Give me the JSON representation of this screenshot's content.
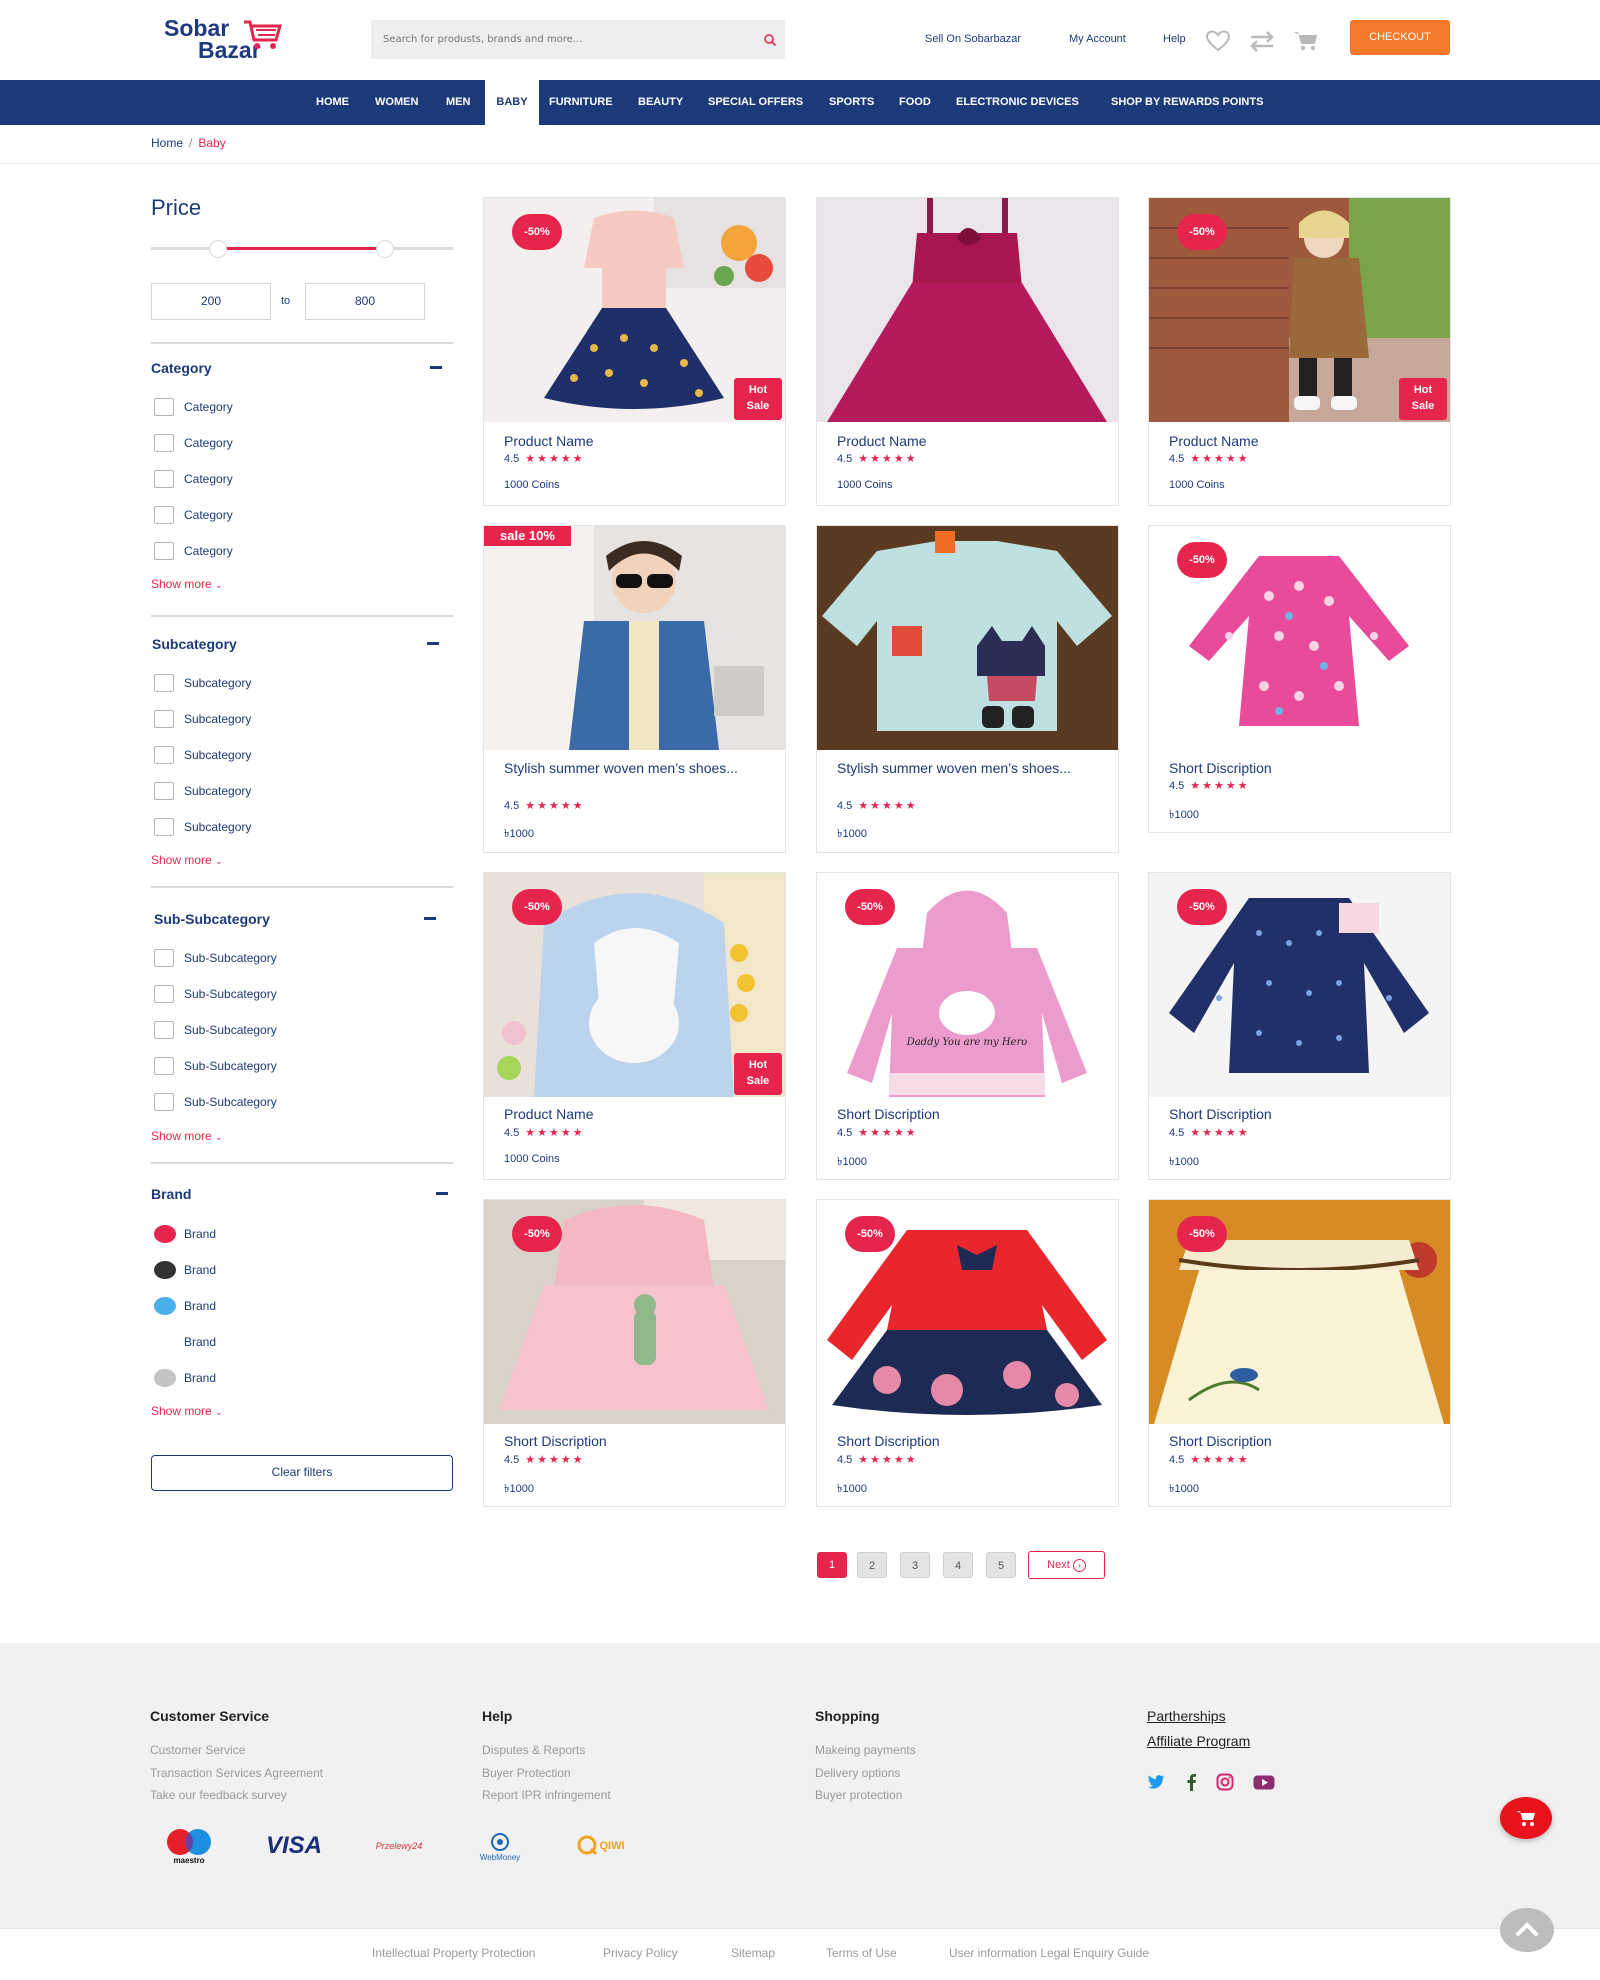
{
  "header": {
    "logo_line1": "Sobar",
    "logo_line2": "Bazar",
    "search_placeholder": "Search for produsts, brands and more...",
    "links": [
      "Sell On Sobarbazar",
      "My Account",
      "Help"
    ],
    "checkout_label": "CHECKOUT",
    "icons": [
      "heart-icon",
      "compare-icon",
      "cart-icon",
      "search-icon"
    ]
  },
  "nav": {
    "items": [
      "HOME",
      "WOMEN",
      "MEN",
      "BABY",
      "FURNITURE",
      "BEAUTY",
      "SPECIAL OFFERS",
      "SPORTS",
      "FOOD",
      "ELECTRONIC DEVICES",
      "SHOP BY REWARDS POINTS"
    ],
    "active": "BABY"
  },
  "breadcrumb": {
    "home": "Home",
    "separator": "/",
    "current": "Baby"
  },
  "sidebar": {
    "price": {
      "title": "Price",
      "min": "200",
      "max": "800",
      "to_label": "to"
    },
    "category": {
      "title": "Category",
      "items": [
        "Category",
        "Category",
        "Category",
        "Category",
        "Category"
      ],
      "show_more": "Show more"
    },
    "subcategory": {
      "title": "Subcategory",
      "items": [
        "Subcategory",
        "Subcategory",
        "Subcategory",
        "Subcategory",
        "Subcategory"
      ],
      "show_more": "Show more"
    },
    "subsubcategory": {
      "title": "Sub-Subcategory",
      "items": [
        "Sub-Subcategory",
        "Sub-Subcategory",
        "Sub-Subcategory",
        "Sub-Subcategory",
        "Sub-Subcategory"
      ],
      "show_more": "Show more"
    },
    "brand": {
      "title": "Brand",
      "items": [
        {
          "label": "Brand",
          "color": "#e6254f"
        },
        {
          "label": "Brand",
          "color": "#333333"
        },
        {
          "label": "Brand",
          "color": "#4ab0ea"
        },
        {
          "label": "Brand",
          "color": "#ffffff"
        },
        {
          "label": "Brand",
          "color": "#c4c4c4"
        }
      ],
      "show_more": "Show more"
    },
    "clear_filters": "Clear filters"
  },
  "products": [
    {
      "name": "Product Name",
      "rating": "4.5",
      "stars": "★★★★★",
      "price": "1000 Coins",
      "badge_discount": "-50%",
      "badge_hot": [
        "Hot",
        "Sale"
      ],
      "image": "dress-peach-navy"
    },
    {
      "name": "Product Name",
      "rating": "4.5",
      "stars": "★★★★★",
      "price": "1000 Coins",
      "image": "dress-magenta"
    },
    {
      "name": "Product Name",
      "rating": "4.5",
      "stars": "★★★★★",
      "price": "1000 Coins",
      "badge_discount": "-50%",
      "badge_hot": [
        "Hot",
        "Sale"
      ],
      "image": "girl-brown-coat"
    },
    {
      "name": "Stylish summer woven men’s shoes...",
      "rating": "4.5",
      "stars": "★★★★★",
      "price": "৳1000",
      "badge_sale": "sale 10%",
      "image": "girl-denim-jacket"
    },
    {
      "name": "Stylish summer woven men’s shoes...",
      "rating": "4.5",
      "stars": "★★★★★",
      "price": "৳1000",
      "image": "cat-sweatshirt"
    },
    {
      "name": "Short Discription",
      "rating": "4.5",
      "stars": "★★★★★",
      "price": "৳1000",
      "badge_discount": "-50%",
      "image": "pink-printed-dress"
    },
    {
      "name": "Product Name",
      "rating": "4.5",
      "stars": "★★★★★",
      "price": "1000 Coins",
      "badge_discount": "-50%",
      "badge_hot": [
        "Hot",
        "Sale"
      ],
      "image": "bunny-jacket"
    },
    {
      "name": "Short Discription",
      "rating": "4.5",
      "stars": "★★★★★",
      "price": "৳1000",
      "badge_discount": "-50%",
      "image": "pink-hoodie"
    },
    {
      "name": "Short Discription",
      "rating": "4.5",
      "stars": "★★★★★",
      "price": "৳1000",
      "badge_discount": "-50%",
      "image": "navy-shirt"
    },
    {
      "name": "Short Discription",
      "rating": "4.5",
      "stars": "★★★★★",
      "price": "৳1000",
      "badge_discount": "-50%",
      "image": "pink-raincoat"
    },
    {
      "name": "Short Discription",
      "rating": "4.5",
      "stars": "★★★★★",
      "price": "৳1000",
      "badge_discount": "-50%",
      "image": "red-floral-dress"
    },
    {
      "name": "Short Discription",
      "rating": "4.5",
      "stars": "★★★★★",
      "price": "৳1000",
      "badge_discount": "-50%",
      "image": "cream-dress"
    }
  ],
  "product_hoodie_text": "Daddy You are my Hero",
  "pagination": {
    "pages": [
      "1",
      "2",
      "3",
      "4",
      "5"
    ],
    "active": "1",
    "next": "Next"
  },
  "footer": {
    "customer_service": {
      "title": "Customer Service",
      "links": [
        "Customer Service",
        "Transaction Services Agreement",
        "Take our feedback survey"
      ]
    },
    "help": {
      "title": "Help",
      "links": [
        "Disputes & Reports",
        "Buyer Protection",
        "Report IPR infringement"
      ]
    },
    "shopping": {
      "title": "Shopping",
      "links": [
        "Makeing payments",
        "Delivery options",
        "Buyer protection"
      ]
    },
    "partner_links": [
      "Partherships",
      "Affiliate Program"
    ],
    "social": [
      "twitter-icon",
      "facebook-icon",
      "instagram-icon",
      "youtube-icon"
    ],
    "payments": {
      "maestro": "maestro",
      "visa": "VISA",
      "przelewy": "Przelewy24",
      "webmoney": "WebMoney",
      "qiwi": "QIWI"
    },
    "bottom_links": [
      "Intellectual Property Protection",
      "Privacy Policy",
      "Sitemap",
      "Terms of Use",
      "User information Legal Enquiry Guide"
    ]
  },
  "colors": {
    "brand_navy": "#1c3a7a",
    "accent_red": "#e6254f",
    "checkout_orange": "#f27a2a"
  }
}
